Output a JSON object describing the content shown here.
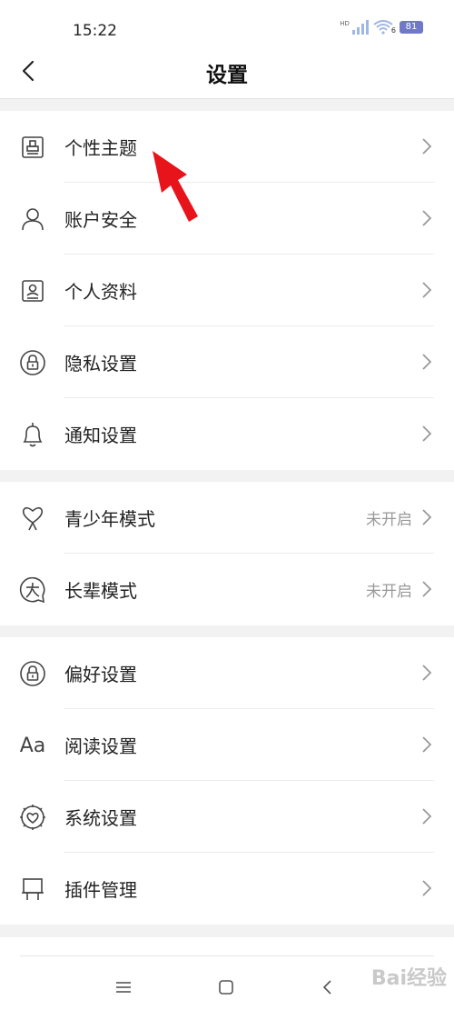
{
  "status_bar": {
    "time": "15:22",
    "network": "HD",
    "wifi_badge": "6",
    "battery": "81"
  },
  "header": {
    "title": "设置"
  },
  "groups": [
    {
      "items": [
        {
          "label": "个性主题",
          "icon": "theme-icon"
        },
        {
          "label": "账户安全",
          "icon": "person-icon"
        },
        {
          "label": "个人资料",
          "icon": "id-card-icon"
        },
        {
          "label": "隐私设置",
          "icon": "lock-icon"
        },
        {
          "label": "通知设置",
          "icon": "bell-icon"
        }
      ]
    },
    {
      "items": [
        {
          "label": "青少年模式",
          "value": "未开启",
          "icon": "heart-balloon-icon"
        },
        {
          "label": "长辈模式",
          "value": "未开启",
          "icon": "elder-icon"
        }
      ]
    },
    {
      "items": [
        {
          "label": "偏好设置",
          "icon": "lock-icon"
        },
        {
          "label": "阅读设置",
          "icon": "font-aa-icon",
          "icon_text": "Aa"
        },
        {
          "label": "系统设置",
          "icon": "heart-gear-icon"
        },
        {
          "label": "插件管理",
          "icon": "plugin-icon"
        }
      ]
    }
  ],
  "watermark": "Bai经验",
  "annotation_color": "#e8141b"
}
